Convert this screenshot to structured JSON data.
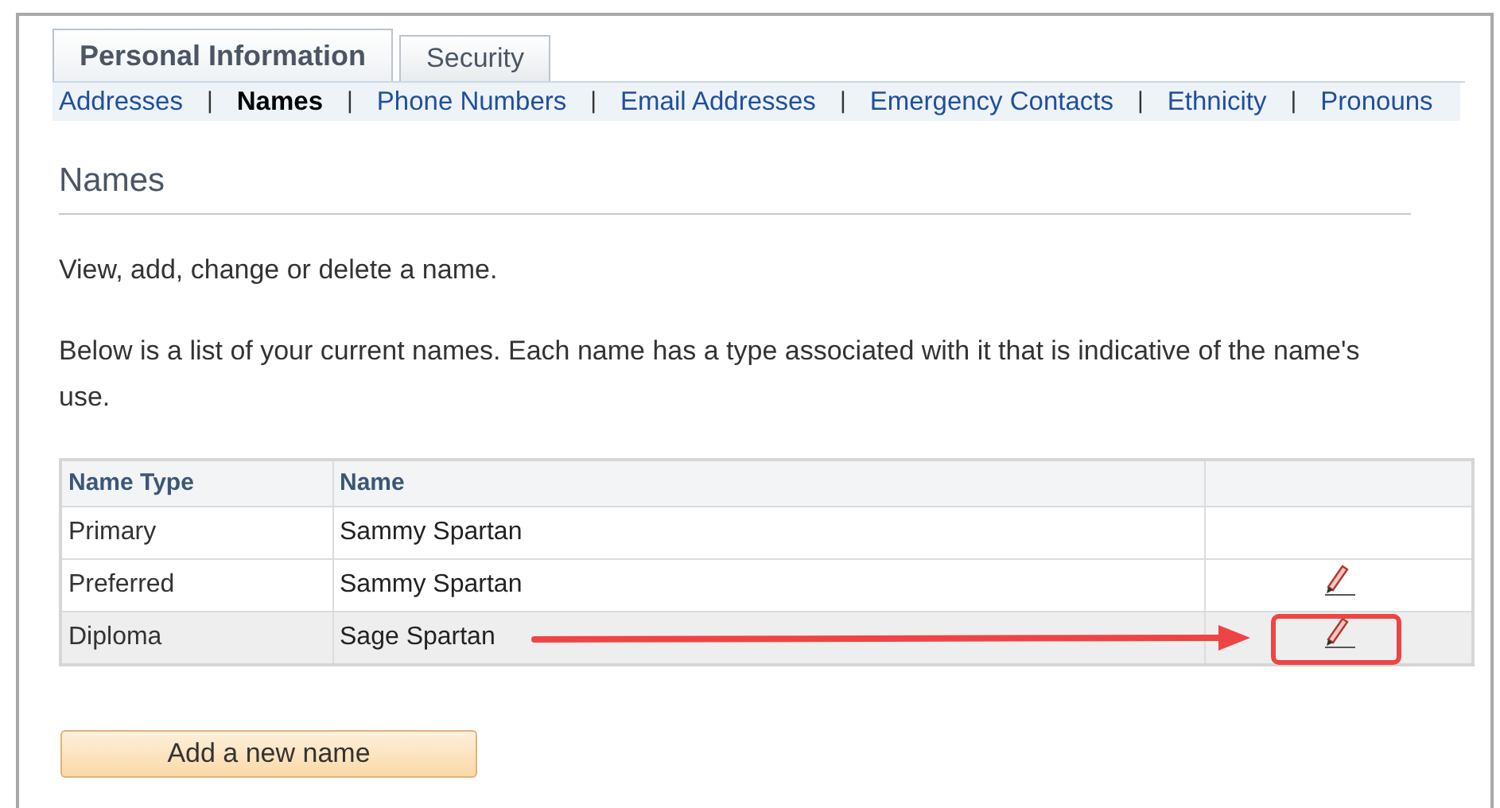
{
  "tabs": [
    {
      "label": "Personal Information",
      "selected": true
    },
    {
      "label": "Security",
      "selected": false
    }
  ],
  "subnav": [
    {
      "label": "Addresses",
      "selected": false
    },
    {
      "label": "Names",
      "selected": true
    },
    {
      "label": "Phone Numbers",
      "selected": false
    },
    {
      "label": "Email Addresses",
      "selected": false
    },
    {
      "label": "Emergency Contacts",
      "selected": false
    },
    {
      "label": "Ethnicity",
      "selected": false
    },
    {
      "label": "Pronouns",
      "selected": false
    }
  ],
  "subnav_separator": "|",
  "heading": "Names",
  "intro": "View, add, change or delete a name.",
  "description": "Below is a list of your current names. Each name has a type associated with it that is indicative of the name's use.",
  "table": {
    "columns": [
      "Name Type",
      "Name"
    ],
    "rows": [
      {
        "name_type": "Primary",
        "name": "Sammy Spartan",
        "editable": false,
        "highlighted": false
      },
      {
        "name_type": "Preferred",
        "name": "Sammy Spartan",
        "editable": true,
        "highlighted": false
      },
      {
        "name_type": "Diploma",
        "name": "Sage Spartan",
        "editable": true,
        "highlighted": true
      }
    ]
  },
  "add_button": "Add a new name"
}
